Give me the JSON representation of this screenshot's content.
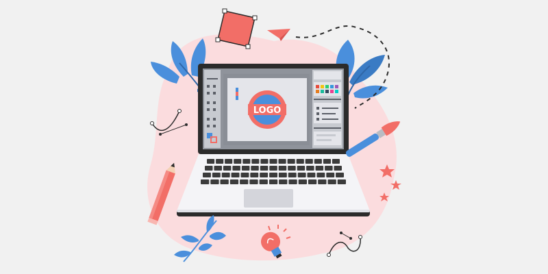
{
  "logo": {
    "text": "LOGO"
  },
  "palette": {
    "background": "#f1f1f1",
    "blob": "#fbdcde",
    "accent_red": "#f26e67",
    "accent_blue": "#4a8fdc",
    "screen_frame": "#2b2b2b",
    "screen_panel": "#b9bcc3",
    "keyboard_deck": "#f4f4f7",
    "key": "#3b3b3b"
  },
  "icons": [
    "laptop-icon",
    "paper-plane-icon",
    "pen-tool-icon",
    "pencil-icon",
    "paintbrush-icon",
    "lightbulb-icon",
    "star-icon",
    "leaf-icon",
    "bezier-curve-icon"
  ],
  "swatch_colors": [
    "#e74c3c",
    "#f1c40f",
    "#2ecc71",
    "#3498db",
    "#9b59b6",
    "#e67e22",
    "#1abc9c",
    "#34495e",
    "#e84393",
    "#00cec9"
  ]
}
